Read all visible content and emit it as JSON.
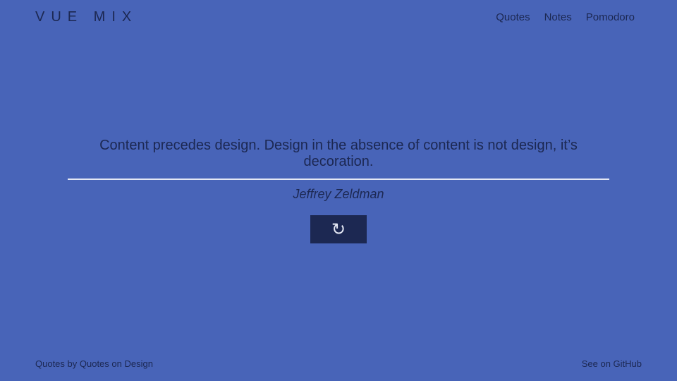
{
  "header": {
    "logo": "VUE MIX",
    "nav": [
      {
        "label": "Quotes"
      },
      {
        "label": "Notes"
      },
      {
        "label": "Pomodoro"
      }
    ]
  },
  "quote": {
    "text": "Content precedes design. Design in the absence of content is not design, it’s decoration.",
    "author": "Jeffrey Zeldman"
  },
  "refresh_button": {
    "icon": "refresh-icon",
    "glyph": "↻"
  },
  "footer": {
    "credit": "Quotes by Quotes on Design",
    "github_link": "See on GitHub"
  },
  "colors": {
    "background": "#4864b8",
    "text": "#1c2852",
    "divider": "#e4e8f4",
    "button": "#1c2852"
  }
}
